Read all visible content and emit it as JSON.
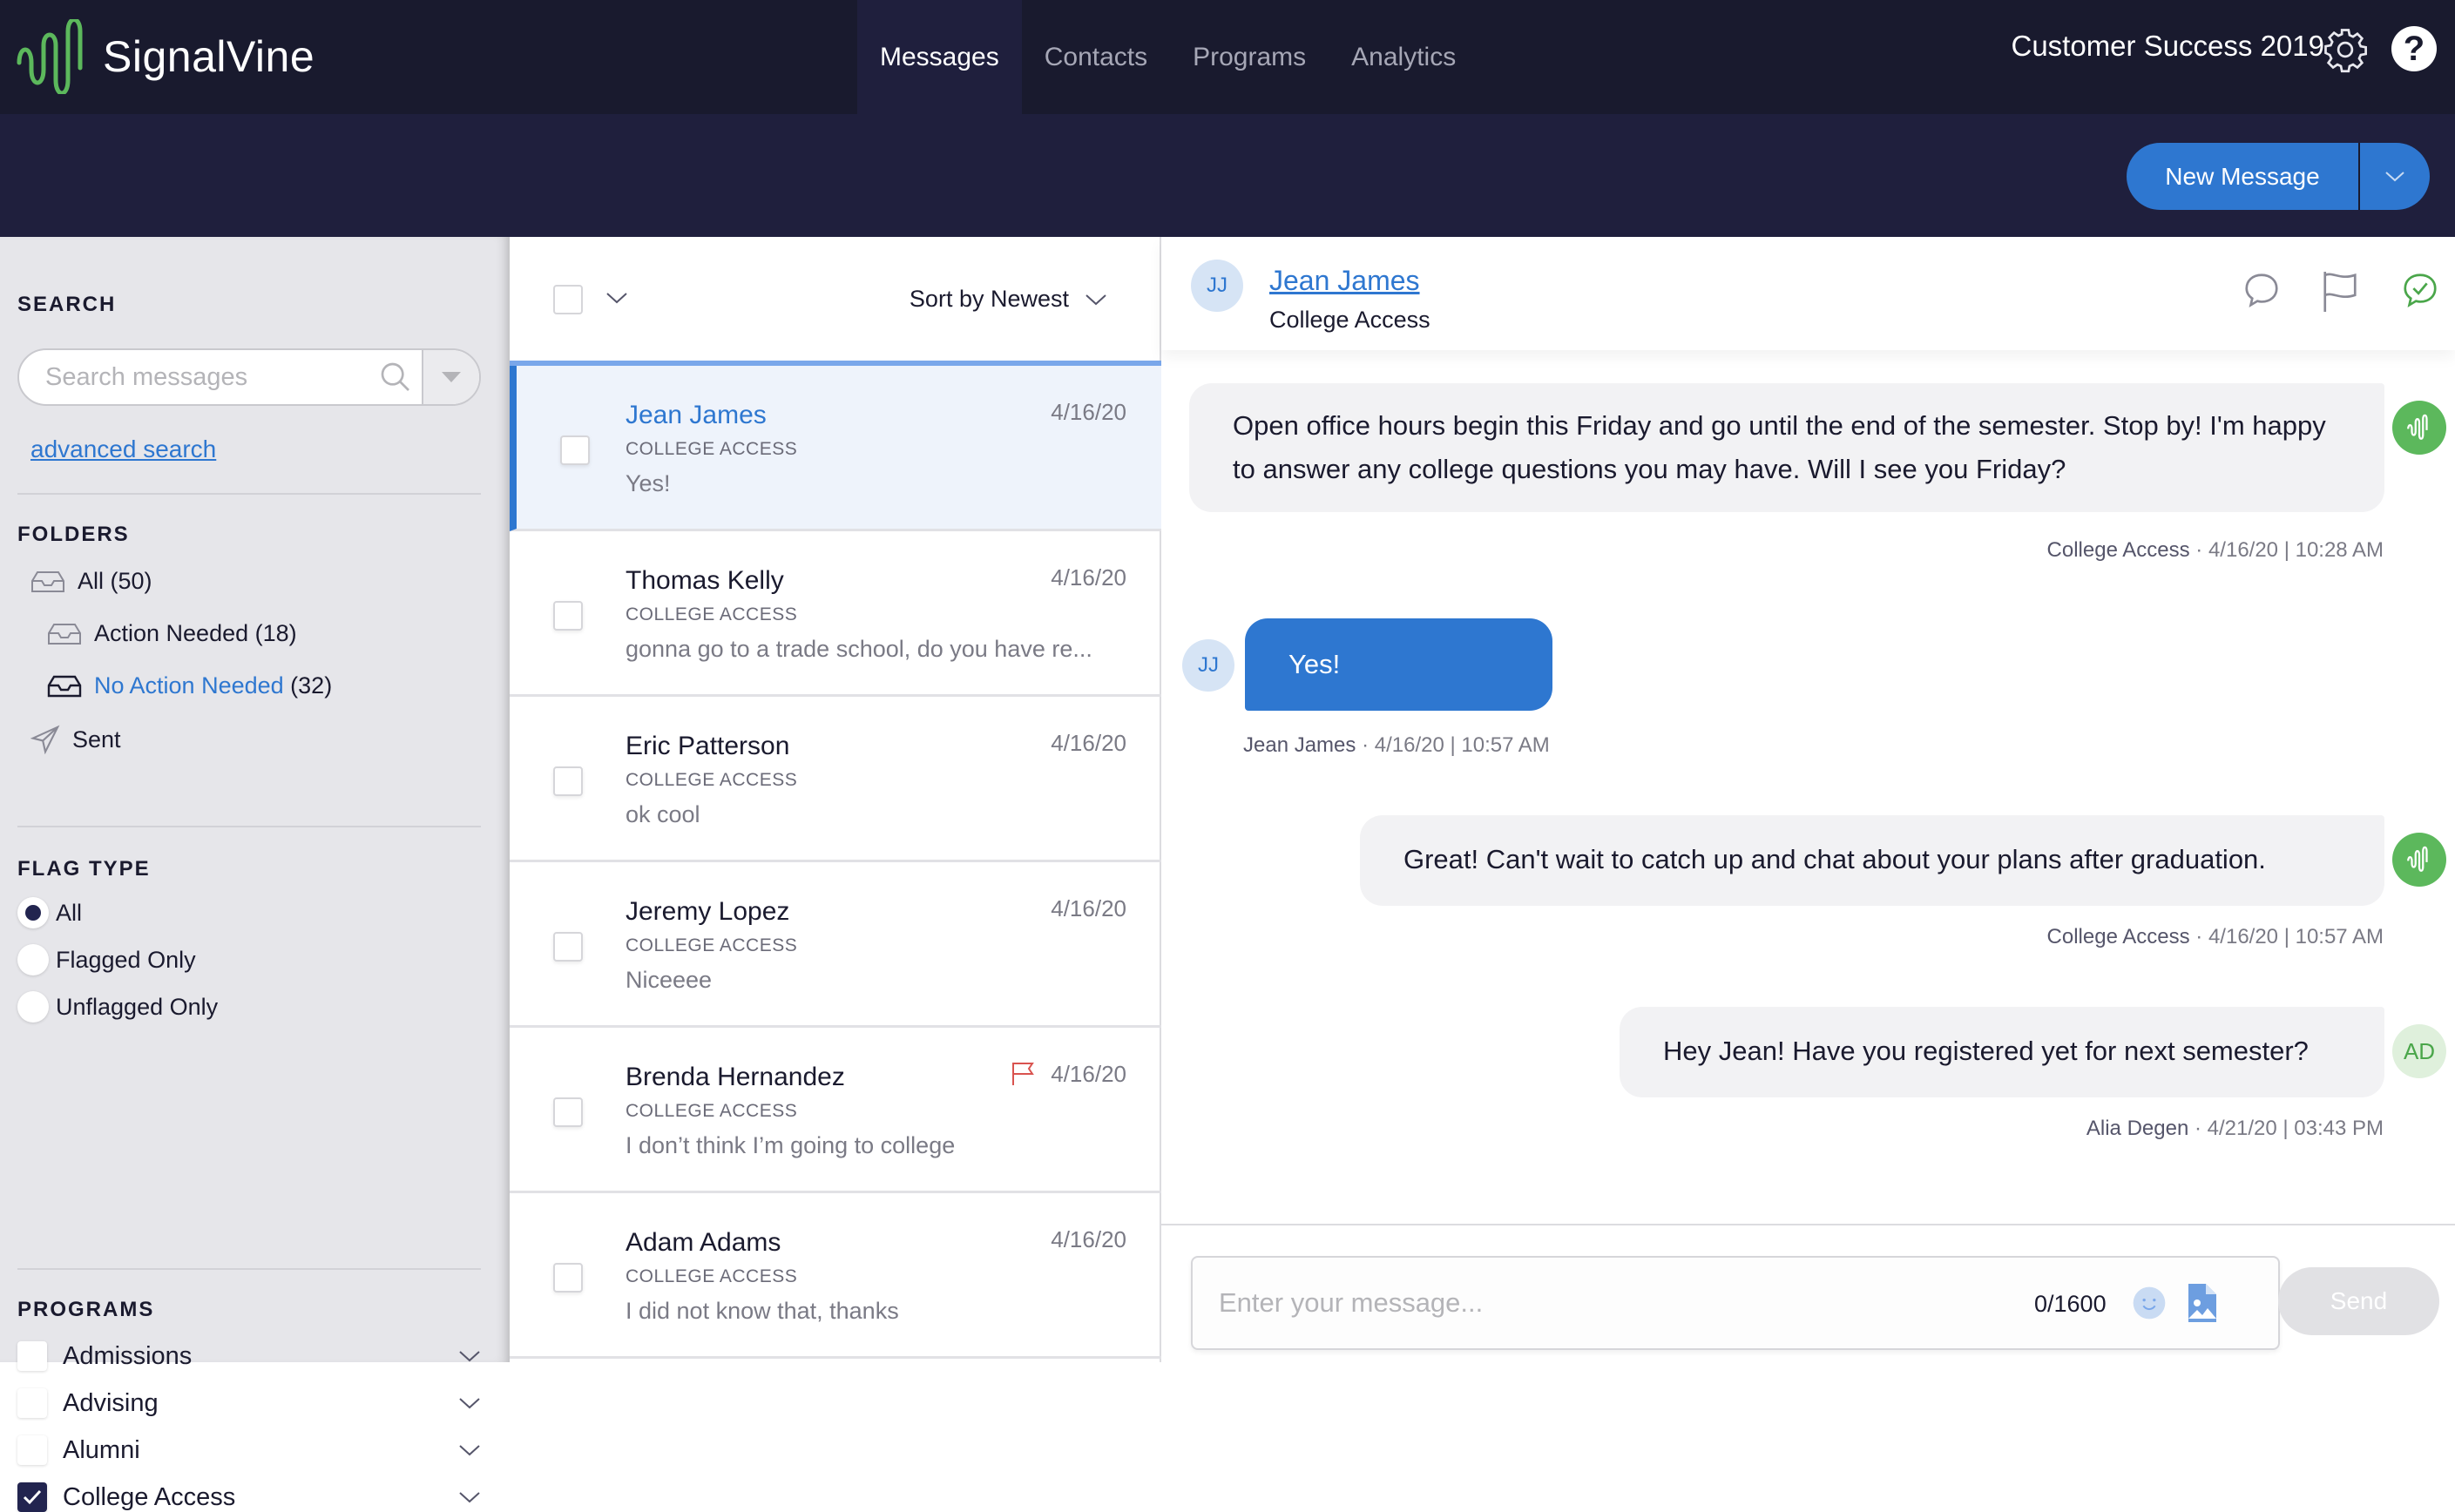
{
  "app": {
    "brand": "SignalVine",
    "org_name": "Customer Success 2019"
  },
  "nav": {
    "tabs": [
      {
        "label": "Messages",
        "active": true
      },
      {
        "label": "Contacts",
        "active": false
      },
      {
        "label": "Programs",
        "active": false
      },
      {
        "label": "Analytics",
        "active": false
      }
    ]
  },
  "toolbar": {
    "new_message_label": "New Message"
  },
  "sidebar": {
    "search_title": "SEARCH",
    "search_placeholder": "Search messages",
    "advanced_search": "advanced search",
    "folders_title": "FOLDERS",
    "folders": [
      {
        "label": "All",
        "count": "(50)",
        "active": false
      },
      {
        "label": "Action Needed",
        "count": "(18)",
        "active": false
      },
      {
        "label": "No Action Needed",
        "count": "(32)",
        "active": true
      },
      {
        "label": "Sent",
        "count": "",
        "active": false
      }
    ],
    "flag_title": "FLAG TYPE",
    "flag_options": [
      {
        "label": "All",
        "selected": true
      },
      {
        "label": "Flagged Only",
        "selected": false
      },
      {
        "label": "Unflagged Only",
        "selected": false
      }
    ],
    "programs_title": "PROGRAMS",
    "programs": [
      {
        "label": "Admissions",
        "checked": false
      },
      {
        "label": "Advising",
        "checked": false
      },
      {
        "label": "Alumni",
        "checked": false
      },
      {
        "label": "College Access",
        "checked": true
      }
    ]
  },
  "list": {
    "sort_label": "Sort by Newest",
    "rows": [
      {
        "name": "Jean James",
        "program": "COLLEGE ACCESS",
        "preview": "Yes!",
        "date": "4/16/20",
        "selected": true,
        "flagged": false
      },
      {
        "name": "Thomas Kelly",
        "program": "COLLEGE ACCESS",
        "preview": "gonna go to a trade school, do you have re...",
        "date": "4/16/20",
        "selected": false,
        "flagged": false
      },
      {
        "name": "Eric Patterson",
        "program": "COLLEGE ACCESS",
        "preview": "ok cool",
        "date": "4/16/20",
        "selected": false,
        "flagged": false
      },
      {
        "name": "Jeremy Lopez",
        "program": "COLLEGE ACCESS",
        "preview": "Niceeee",
        "date": "4/16/20",
        "selected": false,
        "flagged": false
      },
      {
        "name": "Brenda Hernandez",
        "program": "COLLEGE ACCESS",
        "preview": "I don’t think I’m going to college",
        "date": "4/16/20",
        "selected": false,
        "flagged": true
      },
      {
        "name": "Adam Adams",
        "program": "COLLEGE ACCESS",
        "preview": "I did not know that, thanks",
        "date": "4/16/20",
        "selected": false,
        "flagged": false
      }
    ]
  },
  "conversation": {
    "contact_initials": "JJ",
    "contact_name": "Jean James",
    "contact_program": "College Access",
    "messages": [
      {
        "direction": "outgoing",
        "text": "Open office hours begin this Friday and go until the end of the semester. Stop by! I'm happy to answer any college questions you may have. Will I see you Friday?",
        "sender": "College Access",
        "timestamp": "4/16/20 | 10:28 AM",
        "avatar": "signalvine"
      },
      {
        "direction": "incoming",
        "text": "Yes!",
        "sender": "Jean James",
        "timestamp": "4/16/20 | 10:57 AM",
        "avatar": "JJ"
      },
      {
        "direction": "outgoing",
        "text": "Great! Can't wait to catch up and chat about your plans after graduation.",
        "sender": "College Access",
        "timestamp": "4/16/20 | 10:57 AM",
        "avatar": "signalvine"
      },
      {
        "direction": "outgoing",
        "text": "Hey Jean! Have you registered yet for next semester?",
        "sender": "Alia Degen",
        "timestamp": "4/21/20 | 03:43 PM",
        "avatar": "AD"
      }
    ],
    "composer_placeholder": "Enter your message...",
    "char_count": "0/1600",
    "send_label": "Send"
  },
  "colors": {
    "accent": "#2e77d0",
    "brand_green": "#5cb85c",
    "nav_bg": "#191a2e",
    "flag_red": "#d9534f"
  }
}
